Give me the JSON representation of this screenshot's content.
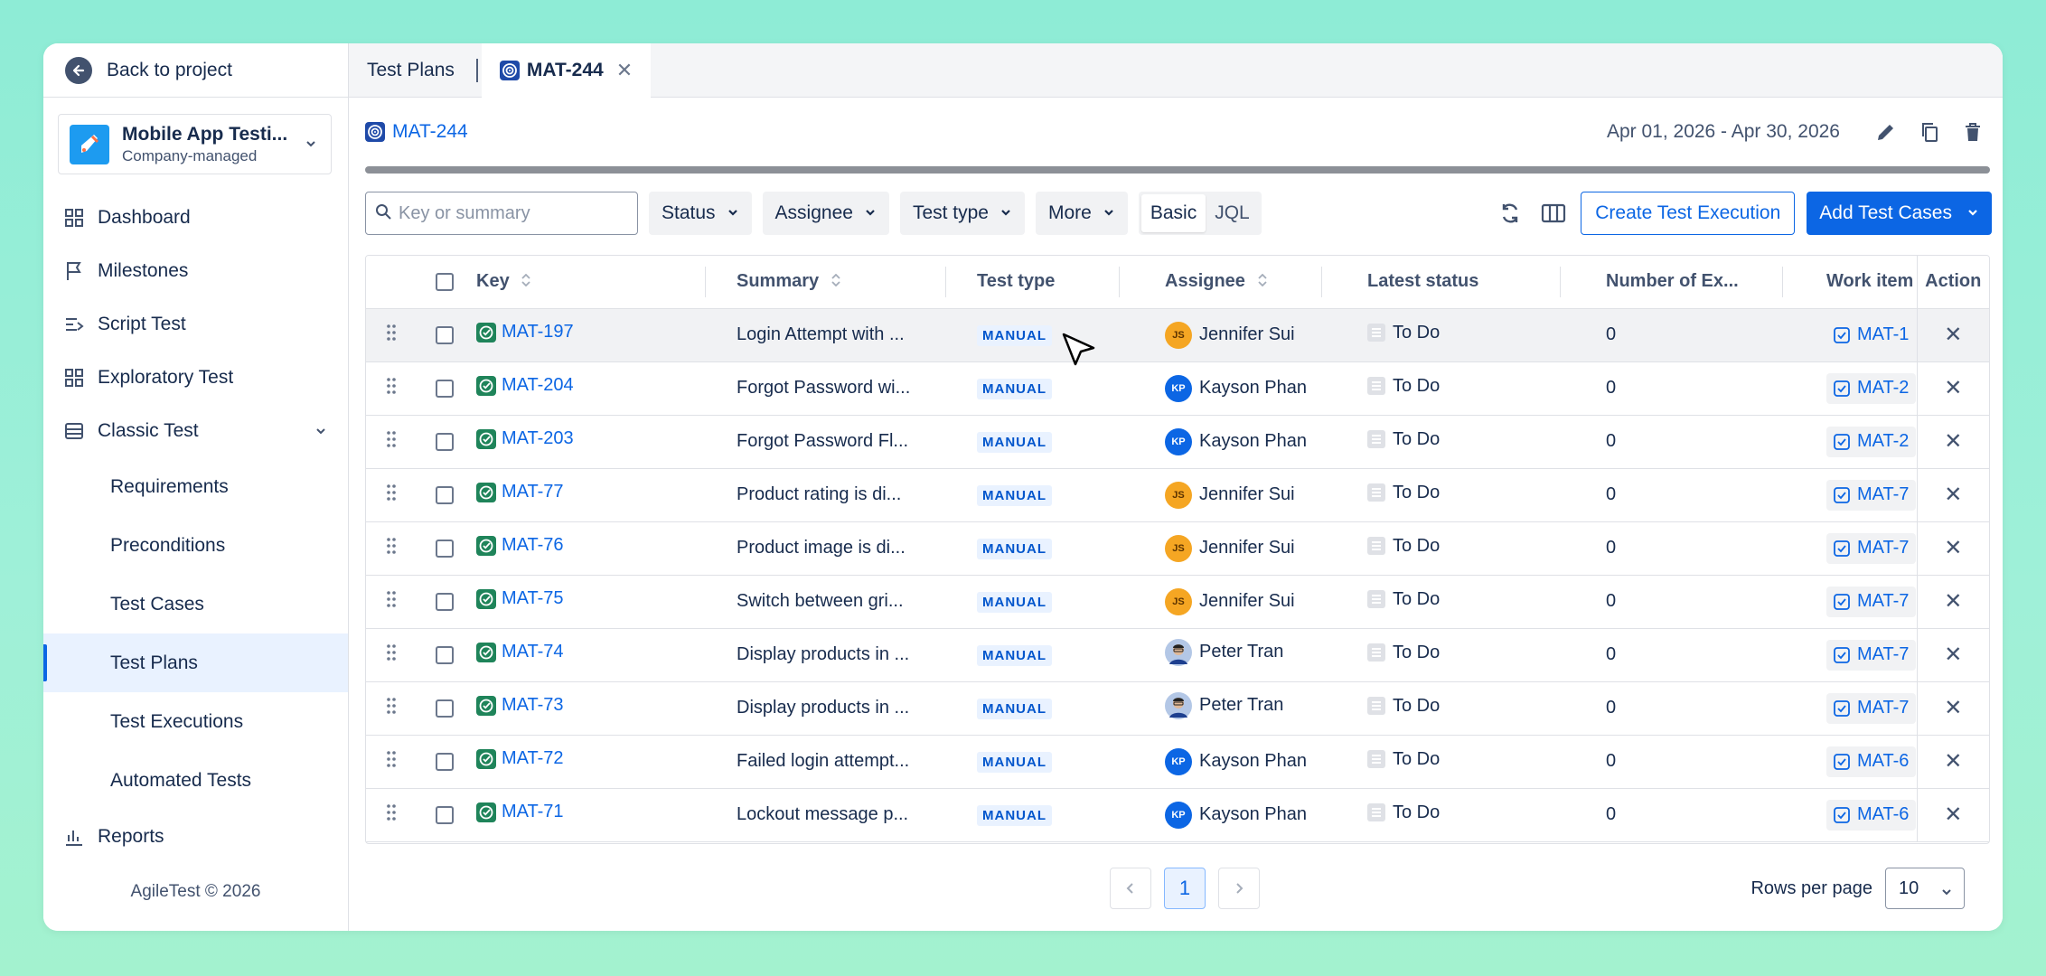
{
  "sidebar": {
    "back_label": "Back to project",
    "project": {
      "name": "Mobile App Testi...",
      "type": "Company-managed"
    },
    "nav": [
      {
        "label": "Dashboard",
        "icon": "dashboard-icon"
      },
      {
        "label": "Milestones",
        "icon": "flag-icon"
      },
      {
        "label": "Script Test",
        "icon": "script-icon"
      },
      {
        "label": "Exploratory Test",
        "icon": "grid-icon"
      },
      {
        "label": "Classic Test",
        "icon": "list-icon"
      }
    ],
    "classic_sub": [
      "Requirements",
      "Preconditions",
      "Test Cases",
      "Test Plans",
      "Test Executions",
      "Automated Tests"
    ],
    "active_sub": "Test Plans",
    "reports_label": "Reports",
    "footer": "AgileTest © 2026"
  },
  "tabs": {
    "first": "Test Plans",
    "active": "MAT-244"
  },
  "header": {
    "breadcrumb": "MAT-244",
    "date_range": "Apr 01, 2026 - Apr 30, 2026"
  },
  "toolbar": {
    "search_placeholder": "Key or summary",
    "filters": [
      "Status",
      "Assignee",
      "Test type",
      "More"
    ],
    "modes": [
      "Basic",
      "JQL"
    ],
    "create_label": "Create Test Execution",
    "add_label": "Add Test Cases"
  },
  "table": {
    "columns": [
      "Key",
      "Summary",
      "Test type",
      "Assignee",
      "Latest status",
      "Number of Ex...",
      "Work item",
      "Action"
    ],
    "rows": [
      {
        "key": "MAT-197",
        "summary": "Login Attempt with ...",
        "type": "MANUAL",
        "assignee": "Jennifer Sui",
        "initials": "JS",
        "avatar_color": "#f5a623",
        "status": "To Do",
        "executions": "0",
        "work_item": "MAT-1"
      },
      {
        "key": "MAT-204",
        "summary": "Forgot Password wi...",
        "type": "MANUAL",
        "assignee": "Kayson Phan",
        "initials": "KP",
        "avatar_color": "#0c66e4",
        "status": "To Do",
        "executions": "0",
        "work_item": "MAT-2"
      },
      {
        "key": "MAT-203",
        "summary": "Forgot Password Fl...",
        "type": "MANUAL",
        "assignee": "Kayson Phan",
        "initials": "KP",
        "avatar_color": "#0c66e4",
        "status": "To Do",
        "executions": "0",
        "work_item": "MAT-2"
      },
      {
        "key": "MAT-77",
        "summary": "Product rating is di...",
        "type": "MANUAL",
        "assignee": "Jennifer Sui",
        "initials": "JS",
        "avatar_color": "#f5a623",
        "status": "To Do",
        "executions": "0",
        "work_item": "MAT-7"
      },
      {
        "key": "MAT-76",
        "summary": "Product image is di...",
        "type": "MANUAL",
        "assignee": "Jennifer Sui",
        "initials": "JS",
        "avatar_color": "#f5a623",
        "status": "To Do",
        "executions": "0",
        "work_item": "MAT-7"
      },
      {
        "key": "MAT-75",
        "summary": "Switch between gri...",
        "type": "MANUAL",
        "assignee": "Jennifer Sui",
        "initials": "JS",
        "avatar_color": "#f5a623",
        "status": "To Do",
        "executions": "0",
        "work_item": "MAT-7"
      },
      {
        "key": "MAT-74",
        "summary": "Display products in ...",
        "type": "MANUAL",
        "assignee": "Peter Tran",
        "initials": "",
        "avatar_color": "photo",
        "status": "To Do",
        "executions": "0",
        "work_item": "MAT-7"
      },
      {
        "key": "MAT-73",
        "summary": "Display products in ...",
        "type": "MANUAL",
        "assignee": "Peter Tran",
        "initials": "",
        "avatar_color": "photo",
        "status": "To Do",
        "executions": "0",
        "work_item": "MAT-7"
      },
      {
        "key": "MAT-72",
        "summary": "Failed login attempt...",
        "type": "MANUAL",
        "assignee": "Kayson Phan",
        "initials": "KP",
        "avatar_color": "#0c66e4",
        "status": "To Do",
        "executions": "0",
        "work_item": "MAT-6"
      },
      {
        "key": "MAT-71",
        "summary": "Lockout message p...",
        "type": "MANUAL",
        "assignee": "Kayson Phan",
        "initials": "KP",
        "avatar_color": "#0c66e4",
        "status": "To Do",
        "executions": "0",
        "work_item": "MAT-6"
      }
    ]
  },
  "pagination": {
    "current_page": "1",
    "rows_label": "Rows per page",
    "rows_value": "10"
  },
  "colors": {
    "accent": "#0c66e4",
    "active_bg": "#e9f2ff"
  }
}
